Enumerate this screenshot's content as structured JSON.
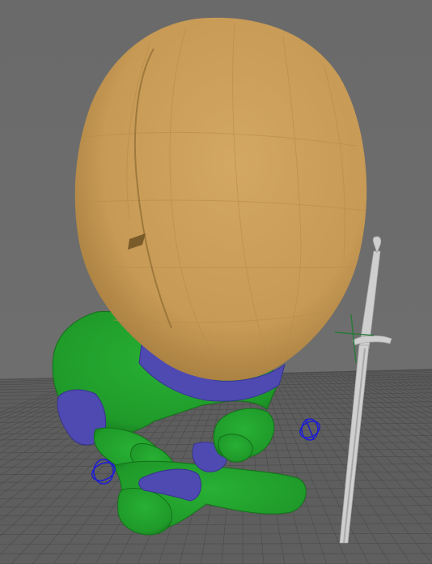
{
  "viewport": {
    "background_top": "#6a6a6a",
    "background_bottom": "#707070",
    "grid_color": "#3e3e3e",
    "grid_line_color": "#4a4a4a"
  },
  "model": {
    "head_color": "#c79a55",
    "head_shadow_color": "#a37a3c",
    "body_color": "#1f9a2a",
    "body_shadow_color": "#137018",
    "accent_color": "#4e4ab2",
    "accent_shadow_color": "#38348a"
  },
  "sword": {
    "color": "#cfcfcf",
    "shadow_color": "#a8a8a8"
  },
  "manipulators": {
    "locator_color": "#2a7a3a",
    "ik_control_color": "#1c1cd6"
  }
}
